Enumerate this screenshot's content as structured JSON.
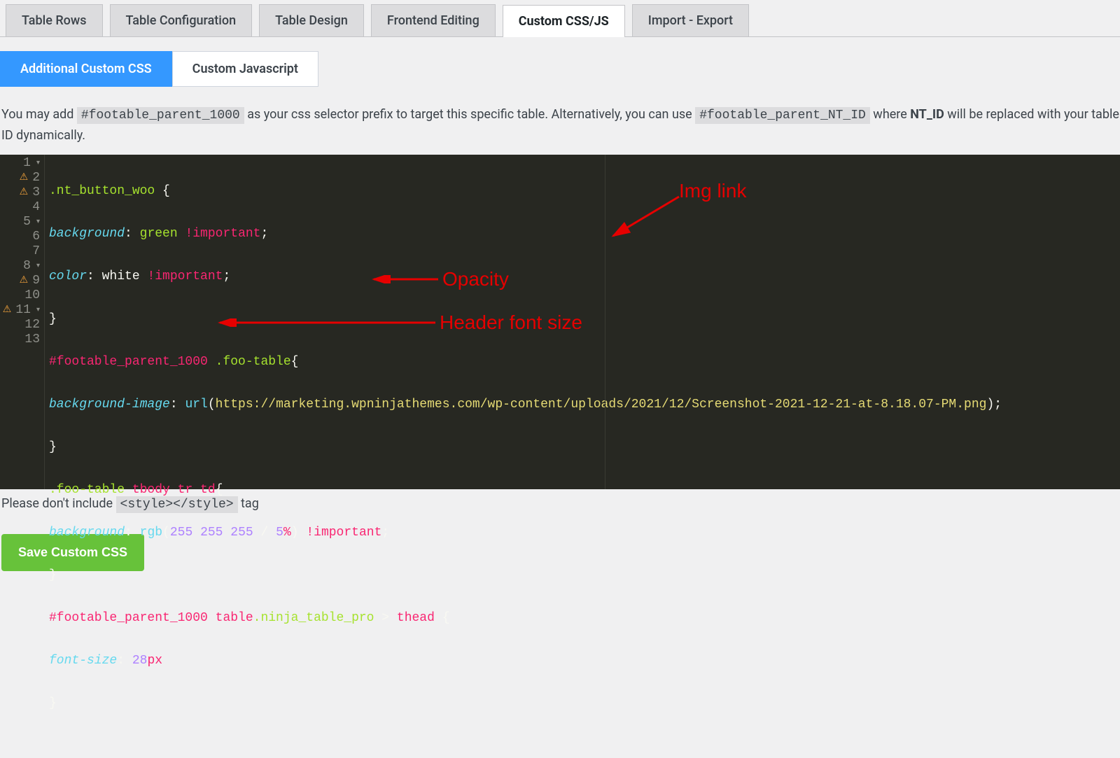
{
  "mainTabs": [
    {
      "label": "Table Rows",
      "active": false
    },
    {
      "label": "Table Configuration",
      "active": false
    },
    {
      "label": "Table Design",
      "active": false
    },
    {
      "label": "Frontend Editing",
      "active": false
    },
    {
      "label": "Custom CSS/JS",
      "active": true
    },
    {
      "label": "Import - Export",
      "active": false
    }
  ],
  "subTabs": [
    {
      "label": "Additional Custom CSS",
      "active": true
    },
    {
      "label": "Custom Javascript",
      "active": false
    }
  ],
  "help": {
    "pre": "You may add ",
    "code1": "#footable_parent_1000",
    "mid": " as your css selector prefix to target this specific table. Alternatively, you can use ",
    "code2": "#footable_parent_NT_ID",
    "post1": " where ",
    "strong": "NT_ID",
    "post2": " will be replaced with your table ID dynamically."
  },
  "editor": {
    "warningLines": [
      2,
      3,
      9,
      11
    ],
    "foldLines": [
      1,
      5,
      8,
      11
    ],
    "lineCount": 13,
    "lines": {
      "l1": {
        "cls": ".nt_button_woo",
        "brace": " {"
      },
      "l2": {
        "prop": "background",
        "colon": ": ",
        "val": "green",
        "imp": " !important",
        "semi": ";"
      },
      "l3": {
        "prop": "color",
        "colon": ": ",
        "val": "white",
        "imp": " !important",
        "semi": ";"
      },
      "l4": {
        "brace": "}"
      },
      "l5": {
        "id": "#footable_parent_1000",
        "cls": " .foo-table",
        "brace": "{"
      },
      "l6": {
        "prop": "background-image",
        "colon": ": ",
        "fn": "url",
        "paren1": "(",
        "url": "https://marketing.wpninjathemes.com/wp-content/uploads/2021/12/Screenshot-2021-12-21-at-8.18.07-PM.png",
        "paren2": ")",
        "semi": ";"
      },
      "l7": {
        "brace": "}"
      },
      "l8": {
        "cls": ".foo-table",
        "tag": " tbody tr td",
        "brace": "{"
      },
      "l9": {
        "prop": "background",
        "colon": ": ",
        "fn": "rgb",
        "paren1": "(",
        "n1": "255",
        "sp1": " ",
        "n2": "255",
        "sp2": " ",
        "n3": "255",
        "slash": " / ",
        "n4": "5",
        "unit": "%",
        "paren2": ")",
        "imp": " !important",
        "semi": ";"
      },
      "l10": {
        "brace": "}"
      },
      "l11": {
        "id": "#footable_parent_1000",
        "tag": " table",
        "cls2": ".ninja_table_pro",
        "combo": " > ",
        "tag2": "thead",
        "brace": " {"
      },
      "l12": {
        "prop": "font-size",
        "colon": ": ",
        "num": "28",
        "unit": "px"
      },
      "l13": {
        "brace": "}"
      }
    }
  },
  "annotations": {
    "imgLink": "Img link",
    "opacity": "Opacity",
    "headerFont": "Header font size"
  },
  "dontInclude": {
    "pre": "Please don't include ",
    "code": "<style></style>",
    "post": " tag"
  },
  "saveButton": "Save Custom CSS"
}
